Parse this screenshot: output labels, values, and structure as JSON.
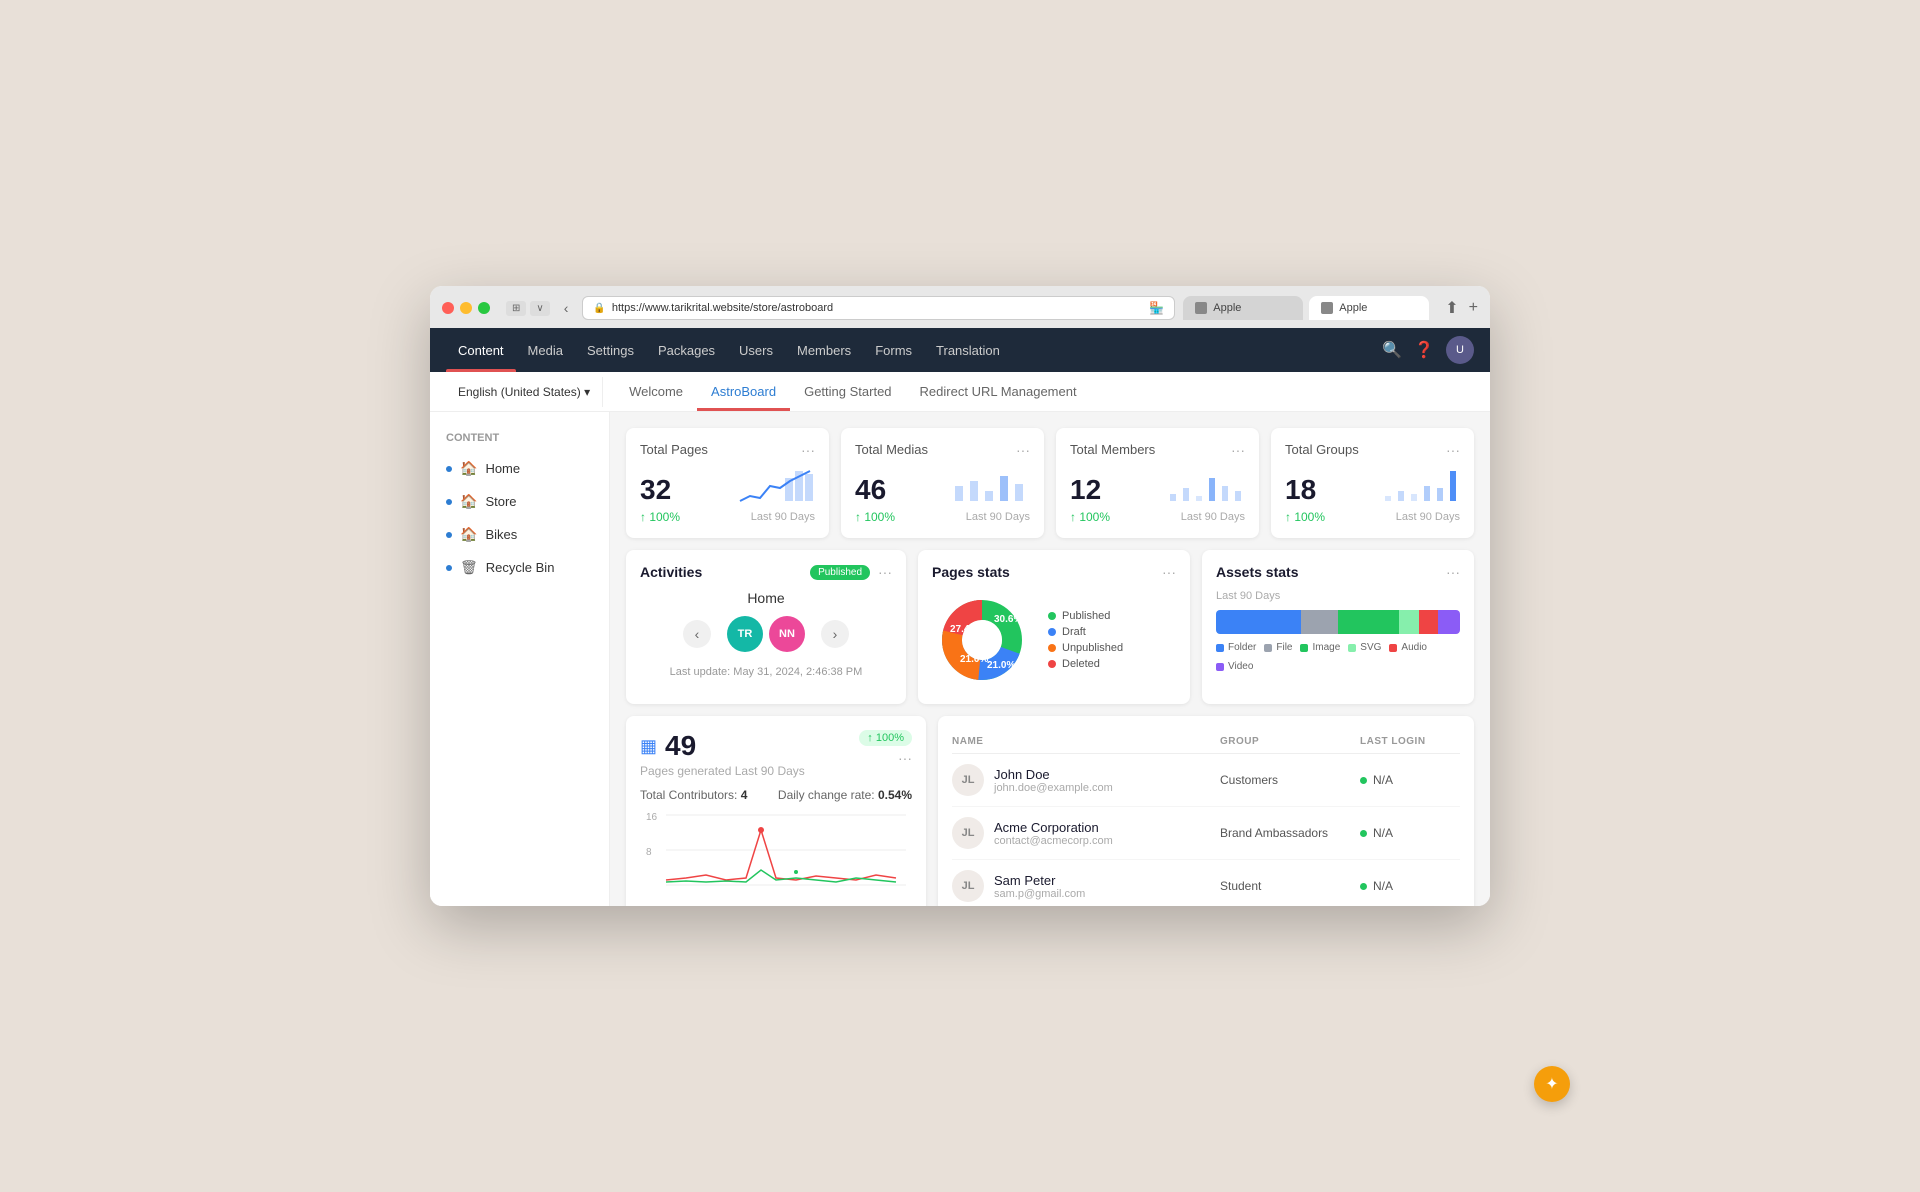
{
  "browser": {
    "url": "https://www.tarikrital.website/store/astroboard",
    "tab1_label": "Apple",
    "tab2_label": "Apple",
    "back_arrow": "‹",
    "forward_arrow": "›"
  },
  "topnav": {
    "items": [
      {
        "id": "content",
        "label": "Content",
        "active": true
      },
      {
        "id": "media",
        "label": "Media"
      },
      {
        "id": "settings",
        "label": "Settings"
      },
      {
        "id": "packages",
        "label": "Packages"
      },
      {
        "id": "users",
        "label": "Users"
      },
      {
        "id": "members",
        "label": "Members"
      },
      {
        "id": "forms",
        "label": "Forms"
      },
      {
        "id": "translation",
        "label": "Translation"
      }
    ]
  },
  "subnav": {
    "lang": "English (United States)",
    "tabs": [
      {
        "id": "welcome",
        "label": "Welcome"
      },
      {
        "id": "astroboard",
        "label": "AstroBoard",
        "active": true
      },
      {
        "id": "getting-started",
        "label": "Getting Started"
      },
      {
        "id": "redirect",
        "label": "Redirect URL Management"
      }
    ]
  },
  "sidebar": {
    "section_title": "Content",
    "items": [
      {
        "id": "home",
        "label": "Home",
        "type": "page"
      },
      {
        "id": "store",
        "label": "Store",
        "type": "page"
      },
      {
        "id": "bikes",
        "label": "Bikes",
        "type": "page"
      },
      {
        "id": "recycle-bin",
        "label": "Recycle Bin",
        "type": "trash"
      }
    ]
  },
  "stats": [
    {
      "id": "total-pages",
      "title": "Total Pages",
      "value": "32",
      "change": "↑ 100%",
      "period": "Last 90 Days"
    },
    {
      "id": "total-medias",
      "title": "Total Medias",
      "value": "46",
      "change": "↑ 100%",
      "period": "Last 90 Days"
    },
    {
      "id": "total-members",
      "title": "Total Members",
      "value": "12",
      "change": "↑ 100%",
      "period": "Last 90 Days"
    },
    {
      "id": "total-groups",
      "title": "Total Groups",
      "value": "18",
      "change": "↑ 100%",
      "period": "Last 90 Days"
    }
  ],
  "activities": {
    "title": "Activities",
    "badge": "Published",
    "home_label": "Home",
    "users": [
      {
        "initials": "TR",
        "color": "ua-teal"
      },
      {
        "initials": "NN",
        "color": "ua-pink"
      }
    ],
    "last_update": "Last update: May 31, 2024, 2:46:38 PM"
  },
  "pages_stats": {
    "title": "Pages stats",
    "segments": [
      {
        "label": "Published",
        "color": "#22c55e",
        "value": 30.6
      },
      {
        "label": "Draft",
        "color": "#3b82f6",
        "value": 21.0
      },
      {
        "label": "Unpublished",
        "color": "#f97316",
        "value": 27.4
      },
      {
        "label": "Deleted",
        "color": "#ef4444",
        "value": 21.0
      }
    ]
  },
  "assets_stats": {
    "title": "Assets stats",
    "period": "Last 90 Days",
    "bars": [
      {
        "label": "Folder",
        "color": "#3b82f6",
        "width": 35
      },
      {
        "label": "File",
        "color": "#9ca3af",
        "width": 15
      },
      {
        "label": "Image",
        "color": "#22c55e",
        "width": 25
      },
      {
        "label": "SVG",
        "color": "#86efac",
        "width": 8
      },
      {
        "label": "Audio",
        "color": "#ef4444",
        "width": 8
      },
      {
        "label": "Video",
        "color": "#8b5cf6",
        "width": 9
      }
    ]
  },
  "pages_generated": {
    "number": "49",
    "badge": "↑ 100%",
    "subtitle": "Pages generated Last 90 Days",
    "total_contributors": "4",
    "daily_change_rate": "0.54%",
    "y_labels": [
      "16",
      "8"
    ]
  },
  "members_table": {
    "columns": [
      "Name",
      "Group",
      "Last Login"
    ],
    "rows": [
      {
        "initials": "JL",
        "name": "John Doe",
        "email": "john.doe@example.com",
        "group": "Customers",
        "last_login": "N/A"
      },
      {
        "initials": "JL",
        "name": "Acme Corporation",
        "email": "contact@acmecorp.com",
        "group": "Brand Ambassadors",
        "last_login": "N/A"
      },
      {
        "initials": "JL",
        "name": "Sam Peter",
        "email": "sam.p@gmail.com",
        "group": "Student",
        "last_login": "N/A"
      }
    ]
  },
  "floating_button": {
    "icon": "✦"
  }
}
